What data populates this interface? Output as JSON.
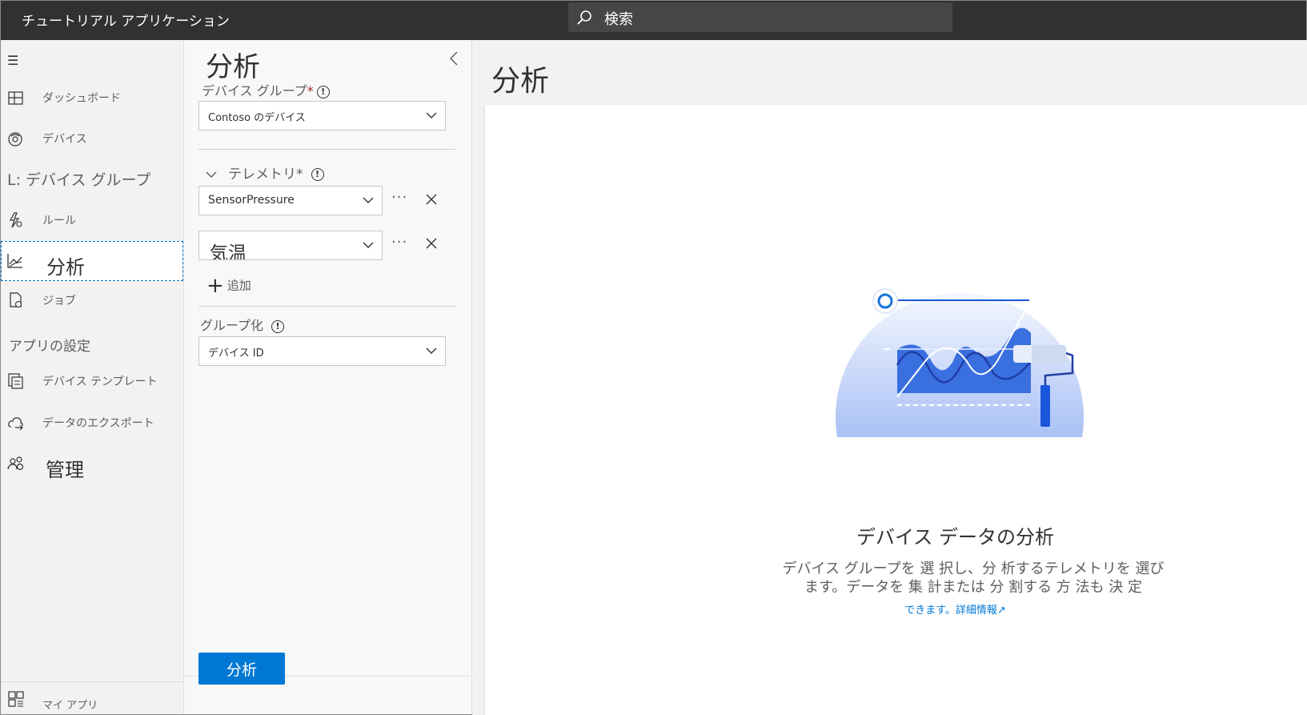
{
  "app": {
    "title": "チュートリアル アプリケーション"
  },
  "search": {
    "placeholder": "検索"
  },
  "nav": {
    "items": [
      {
        "label": "ダッシュボード",
        "icon": "dashboard-icon"
      },
      {
        "label": "デバイス",
        "icon": "device-icon"
      },
      {
        "label": "L: デバイス グループ",
        "icon": ""
      },
      {
        "label": "ルール",
        "icon": "rules-icon"
      },
      {
        "label": "分析",
        "icon": "analytics-icon"
      },
      {
        "label": "ジョブ",
        "icon": "jobs-icon"
      }
    ],
    "section_app_settings": "アプリの設定",
    "settings_items": [
      {
        "label": "デバイス テンプレート",
        "icon": "device-template-icon"
      },
      {
        "label": "データのエクスポート",
        "icon": "data-export-icon"
      },
      {
        "label": "管理",
        "icon": "administration-icon"
      }
    ],
    "bottom_item": {
      "label": "マイ アプリ",
      "icon": "my-apps-icon"
    }
  },
  "pane": {
    "title": "分析",
    "device_group_label": "デバイス グループ",
    "device_group_value": "Contoso のデバイス",
    "telemetry_label": "テレメトリ",
    "telemetry_items": [
      "SensorPressure",
      "気温"
    ],
    "add_label": "追加",
    "group_by_label": "グループ化",
    "group_by_value": "デバイス ID",
    "analyze_button": "分析"
  },
  "main": {
    "title": "分析",
    "empty_title": "デバイス データの分析",
    "empty_desc": "デバイス グループを 選 択し、分 析するテレメトリを 選びます。データを 集 計または 分 割する 方 法も 決 定",
    "empty_link": "できます。詳細情報"
  },
  "colors": {
    "accent": "#0078d4",
    "topbar": "#323130",
    "nav_bg": "#f3f2f1"
  }
}
